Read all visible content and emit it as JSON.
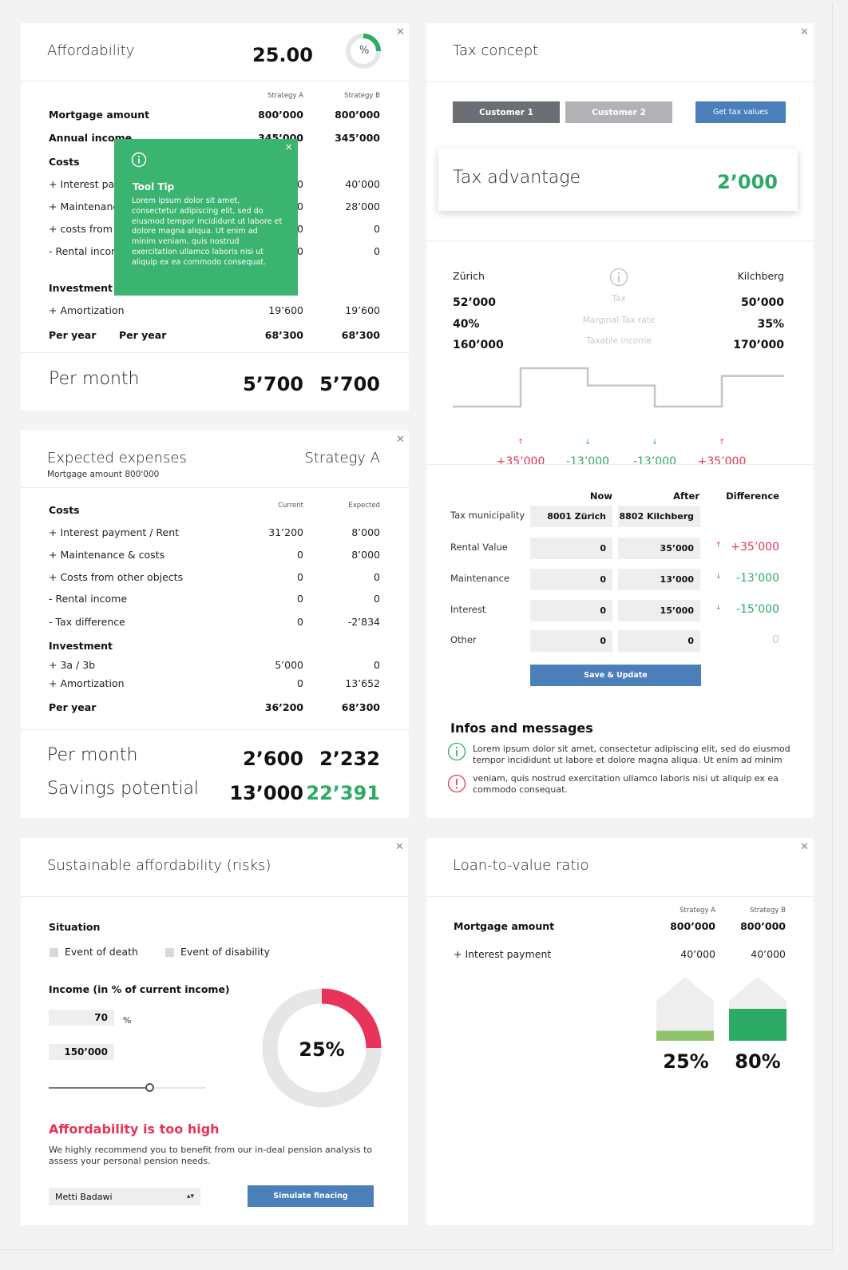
{
  "affordability": {
    "title": "Affordability",
    "value": "25.00",
    "donut_label": "%",
    "donut_fraction": 0.25,
    "col_a": "Strategy A",
    "col_b": "Strategy B",
    "rows": [
      {
        "label": "Mortgage amount",
        "a": "800’000",
        "b": "800’000"
      },
      {
        "label": "Annual income",
        "a": "345’000",
        "b": "345’000"
      },
      {
        "label": "Costs"
      },
      {
        "label": "+ Interest payment",
        "a": "40’000",
        "b": "40’000"
      },
      {
        "label": "+ Maintenance",
        "a": "28’000",
        "b": "28’000"
      },
      {
        "label": "+ costs from other objects",
        "a": "0",
        "b": "0"
      },
      {
        "label": "- Rental income",
        "a": "0",
        "b": "0"
      },
      {
        "label": "Investment"
      },
      {
        "label": "+ Amortization",
        "a": "19’600",
        "b": "19’600"
      }
    ],
    "per_year_label": "Per year",
    "per_year_label2": "Per year",
    "per_year_a": "68’300",
    "per_year_b": "68’300",
    "per_month_label": "Per month",
    "per_month_a": "5’700",
    "per_month_b": "5’700",
    "tooltip": {
      "title": "Tool Tip",
      "text": "Lorem ipsum dolor sit amet, consectetur adipiscing elit, sed do eiusmod tempor incididunt ut labore et dolore magna aliqua. Ut enim ad minim veniam, quis nostrud exercitation ullamco laboris nisi ut aliquip ex ea commodo consequat."
    }
  },
  "tax": {
    "title": "Tax concept",
    "customer1": "Customer 1",
    "customer2": "Customer 2",
    "get_values": "Get tax values",
    "advantage_label": "Tax advantage",
    "advantage_value": "2’000",
    "left_place": "Zürich",
    "right_place": "Kilchberg",
    "compare": [
      {
        "left": "52’000",
        "mid": "Tax",
        "right": "50’000"
      },
      {
        "left": "40%",
        "mid": "Marginal Tax rate",
        "right": "35%"
      },
      {
        "left": "160’000",
        "mid": "Taxable income",
        "right": "170’000"
      }
    ],
    "step_levels": [
      0,
      1,
      0.55,
      0,
      0.8
    ],
    "deltas": [
      {
        "value": "+35’000",
        "dir": "up"
      },
      {
        "value": "-13’000",
        "dir": "down"
      },
      {
        "value": "-13’000",
        "dir": "down"
      },
      {
        "value": "+35’000",
        "dir": "up"
      }
    ],
    "table_headers": {
      "now": "Now",
      "after": "After",
      "diff": "Difference"
    },
    "table": [
      {
        "label": "Tax municipality",
        "now": "8001  Zürich",
        "after": "8802 Kilchberg",
        "diff": "",
        "dir": ""
      },
      {
        "label": "Rental Value",
        "now": "0",
        "after": "35’000",
        "diff": "+35’000",
        "dir": "up"
      },
      {
        "label": "Maintenance",
        "now": "0",
        "after": "13’000",
        "diff": "-13’000",
        "dir": "down"
      },
      {
        "label": "Interest",
        "now": "0",
        "after": "15’000",
        "diff": "-15’000",
        "dir": "down"
      },
      {
        "label": "Other",
        "now": "0",
        "after": "0",
        "diff": "0",
        "dir": "none"
      }
    ],
    "save_label": "Save & Update",
    "infos_title": "Infos and messages",
    "info_text": "Lorem ipsum dolor sit amet, consectetur adipiscing elit, sed do eiusmod tempor incididunt ut labore et dolore magna aliqua. Ut enim ad minim",
    "warn_text": "veniam, quis nostrud exercitation ullamco laboris nisi ut aliquip ex ea commodo consequat."
  },
  "expenses": {
    "title": "Expected expenses",
    "subtitle": "Mortgage amount 800'000",
    "strategy": "Strategy A",
    "costs_label": "Costs",
    "col_current": "Current",
    "col_expected": "Expected",
    "rows": [
      {
        "label": "+ Interest payment / Rent",
        "a": "31’200",
        "b": "8’000"
      },
      {
        "label": "+ Maintenance & costs",
        "a": "0",
        "b": "8’000"
      },
      {
        "label": "+ Costs from other objects",
        "a": "0",
        "b": "0"
      },
      {
        "label": "- Rental income",
        "a": "0",
        "b": "0"
      },
      {
        "label": "- Tax difference",
        "a": "0",
        "b": "-2’834"
      }
    ],
    "investment_label": "Investment",
    "inv_rows": [
      {
        "label": "+ 3a / 3b",
        "a": "5’000",
        "b": "0"
      },
      {
        "label": "+ Amortization",
        "a": "0",
        "b": "13’652"
      }
    ],
    "per_year_label": "Per year",
    "per_year_a": "36’200",
    "per_year_b": "68’300",
    "per_month_label": "Per month",
    "per_month_a": "2’600",
    "per_month_b": "2’232",
    "savings_label": "Savings potential",
    "savings_a": "13’000",
    "savings_b": "22’391"
  },
  "sustainable": {
    "title": "Sustainable affordability (risks)",
    "situation": "Situation",
    "death": "Event of death",
    "disability": "Event of disability",
    "income_label": "Income (in % of current income)",
    "pct_value": "70",
    "pct_unit": "%",
    "amount_value": "150’000",
    "slider_fraction": 0.64,
    "donut_value": "25%",
    "donut_fraction": 0.25,
    "warning_title": "Affordability is too high",
    "warning_text": "We highly recommend you to benefit from our in-deal pension analysis to assess your personal pension needs.",
    "select_value": "Metti Badawi",
    "simulate": "Simulate finacing"
  },
  "ltv": {
    "title": "Loan-to-value ratio",
    "col_a": "Strategy A",
    "col_b": "Strategy B",
    "rows": [
      {
        "label": "Mortgage amount",
        "a": "800’000",
        "b": "800’000",
        "bold": true
      },
      {
        "label": "+ Interest payment",
        "a": "40’000",
        "b": "40’000",
        "bold": false
      }
    ],
    "value_a": "25%",
    "value_b": "80%",
    "fill_a": 0.25,
    "fill_b": 0.8
  },
  "colors": {
    "green": "#2dab66",
    "red": "#e8345a",
    "blue": "#4a7fba",
    "tooltip": "#3bb46f",
    "light_green": "#8fc46a"
  }
}
